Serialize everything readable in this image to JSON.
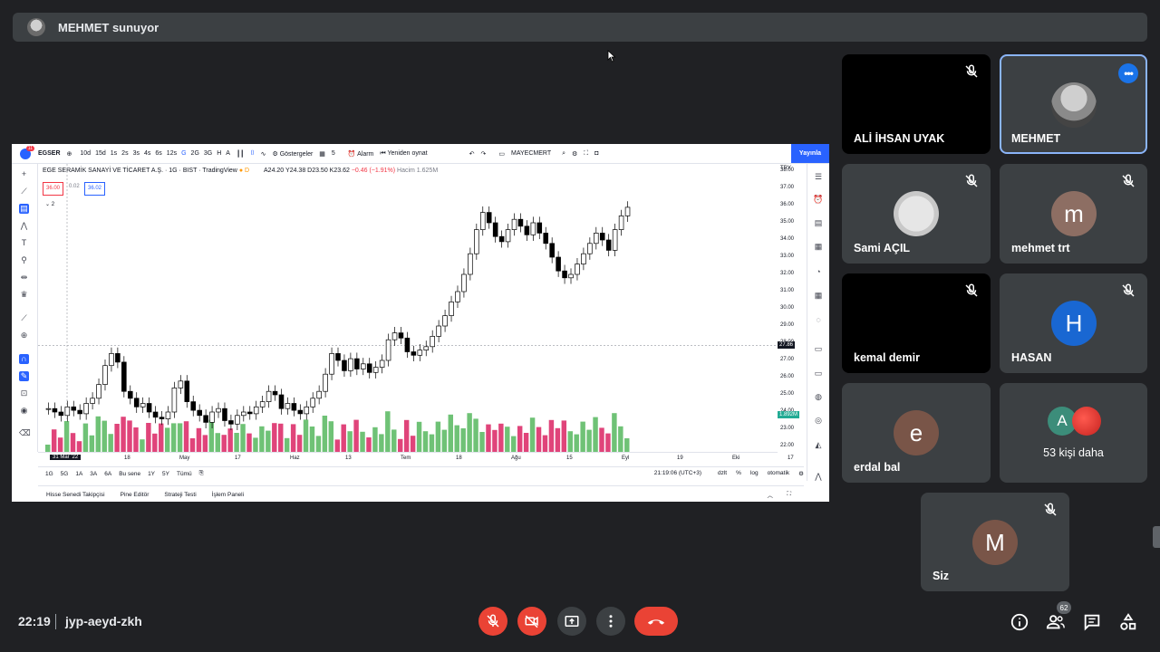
{
  "presenter_banner": {
    "text": "MEHMET sunuyor"
  },
  "tradingview": {
    "notif_count": "11",
    "symbol": "EGSER",
    "toolbar_items": [
      "10d",
      "15d",
      "1s",
      "2s",
      "3s",
      "4s",
      "6s",
      "12s",
      "G",
      "2G",
      "3G",
      "H",
      "A"
    ],
    "indicators_label": "Göstergeler",
    "indicator_count": "5",
    "alarm_label": "Alarm",
    "replay_label": "Yeniden oynat",
    "layout_name": "MAYECMERT",
    "publish_label": "Yayınla",
    "legend": {
      "title": "EGE SERAMİK SANAYİ VE TİCARET A.Ş. · 1G · BIST · TradingView",
      "ohlc": "A24.20 Y24.38 D23.50 K23.62",
      "change": "−0.46 (−1.91%)",
      "volume": "Hacim 1.625M"
    },
    "sell_price": "36.00",
    "spread": "0.02",
    "buy_price": "36.02",
    "collapse_count": "2",
    "currency": "TRY",
    "current_price": "27.86",
    "volume_label": "1.892M",
    "crosshair_date": "31 Mar '22",
    "x_labels": [
      "18",
      "May",
      "17",
      "Haz",
      "13",
      "Tem",
      "18",
      "Ağu",
      "15",
      "Eyl",
      "19",
      "Eki",
      "17"
    ],
    "timeframes": [
      "1G",
      "5G",
      "1A",
      "3A",
      "6A",
      "Bu sene",
      "1Y",
      "5Y",
      "Tümü"
    ],
    "clock": "21:19:06 (UTC+3)",
    "scale_options": [
      "dzlt",
      "%",
      "log",
      "otomatik"
    ],
    "bottom_tabs": [
      "Hisse Senedi Takipçisi",
      "Pine Editör",
      "Strateji Testi",
      "İşlem Paneli"
    ]
  },
  "chart_data": {
    "type": "bar",
    "description": "Candlestick price chart of EGSER (daily) with volume bars",
    "ylim": [
      22,
      38
    ],
    "y_ticks": [
      22,
      23,
      24,
      25,
      26,
      27,
      28,
      29,
      30,
      31,
      32,
      33,
      34,
      35,
      36,
      37,
      38
    ],
    "close_series": [
      24.2,
      24.0,
      23.8,
      24.3,
      24.1,
      23.9,
      24.5,
      24.8,
      25.6,
      26.7,
      27.4,
      26.9,
      25.2,
      24.8,
      24.3,
      24.5,
      24.0,
      23.7,
      23.6,
      24.0,
      25.4,
      25.8,
      24.6,
      24.1,
      23.8,
      23.4,
      24.0,
      24.2,
      23.5,
      23.3,
      23.8,
      24.0,
      23.9,
      24.3,
      24.6,
      25.2,
      25.0,
      24.2,
      24.5,
      24.1,
      23.9,
      24.3,
      24.8,
      25.2,
      26.2,
      27.4,
      27.0,
      26.4,
      27.1,
      26.5,
      26.8,
      26.3,
      26.6,
      27.0,
      28.2,
      28.6,
      28.3,
      27.5,
      27.3,
      27.6,
      27.8,
      28.4,
      29.0,
      29.6,
      30.4,
      31.0,
      32.0,
      33.2,
      34.6,
      35.6,
      35.0,
      34.2,
      33.9,
      34.6,
      35.2,
      34.8,
      34.3,
      35.0,
      34.4,
      33.8,
      33.0,
      32.2,
      31.8,
      32.0,
      32.6,
      33.2,
      33.8,
      34.4,
      34.0,
      33.4,
      34.6,
      35.4,
      35.9
    ]
  },
  "participants": [
    {
      "name": "ALİ İHSAN UYAK"
    },
    {
      "name": "MEHMET"
    },
    {
      "name": "Sami AÇIL"
    },
    {
      "name": "mehmet trt",
      "initial": "m"
    },
    {
      "name": "kemal demir"
    },
    {
      "name": "HASAN",
      "initial": "H"
    },
    {
      "name": "erdal bal",
      "initial": "e"
    },
    {
      "name": "53 kişi daha",
      "initial": "A"
    },
    {
      "name": "Siz",
      "initial": "M"
    }
  ],
  "colors": {
    "avatar_brown": "#795548",
    "avatar_blue": "#1967d2",
    "avatar_teal": "#3c8d7a",
    "avatar_red": "#d93025",
    "accent": "#1a73e8"
  },
  "bottom_bar": {
    "time": "22:19",
    "meeting_code": "jyp-aeyd-zkh",
    "people_count": "62"
  }
}
